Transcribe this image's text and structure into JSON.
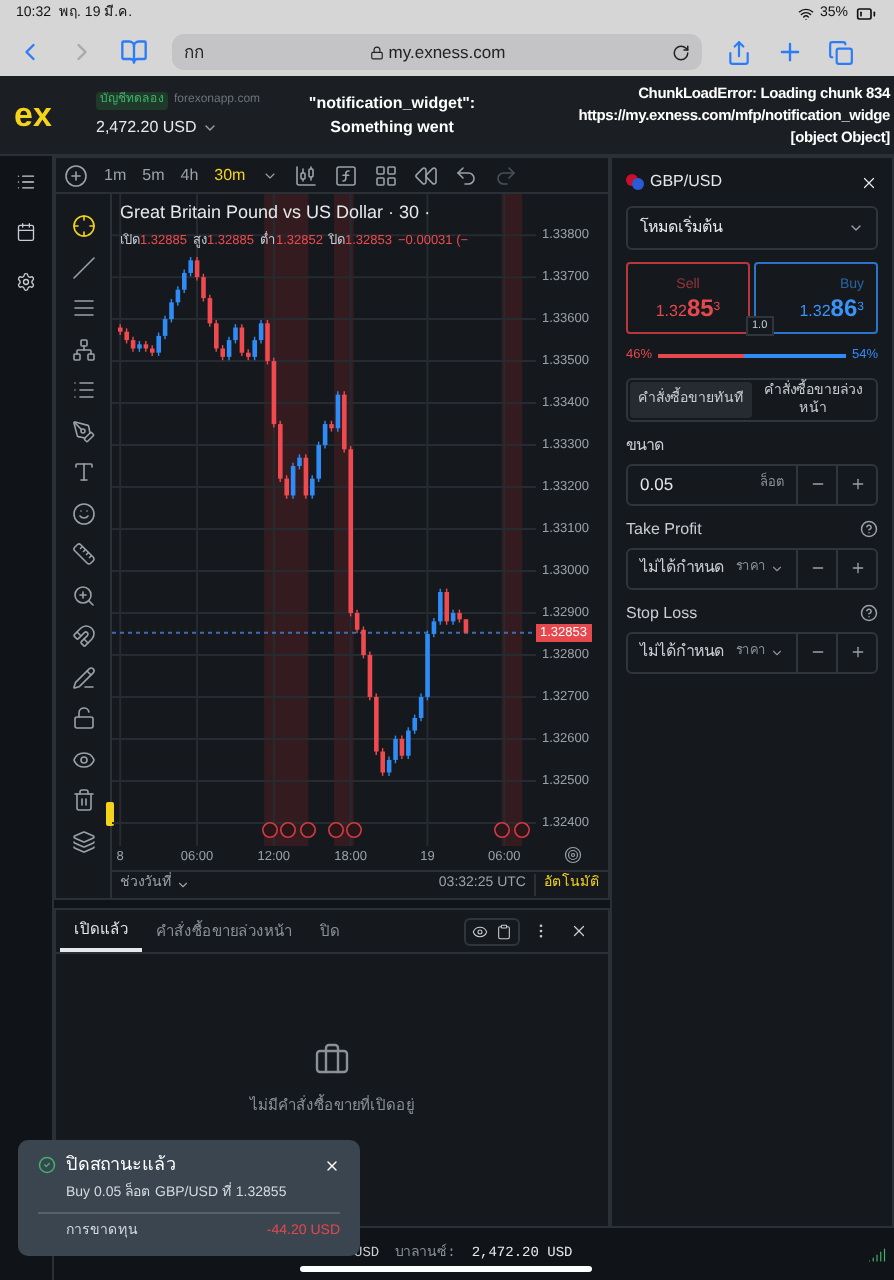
{
  "status_bar": {
    "time": "10:32",
    "date": "พฤ. 19 มี.ค.",
    "battery": "35%"
  },
  "browser": {
    "text_size_button": "กก",
    "url": "my.exness.com"
  },
  "header": {
    "logo": "ex",
    "account_type": "บัญชีทดลอง",
    "server": "forexonapp.com",
    "balance": "2,472.20 USD",
    "widget_error": [
      "\"notification_widget\":",
      "Something went"
    ],
    "chunk_error": [
      "ChunkLoadError: Loading chunk 834",
      "https://my.exness.com/mfp/notification_widge",
      "[object Object]"
    ]
  },
  "chart_toolbar": {
    "timeframes": [
      {
        "label": "1m",
        "selected": false
      },
      {
        "label": "5m",
        "selected": false
      },
      {
        "label": "4h",
        "selected": false
      },
      {
        "label": "30m",
        "selected": true
      }
    ]
  },
  "chart": {
    "title": "Great Britain Pound vs US Dollar · 30 ·",
    "ohlc": [
      {
        "label": "เปิด",
        "value": "1.32885"
      },
      {
        "label": "สูง",
        "value": "1.32885"
      },
      {
        "label": "ต่ำ",
        "value": "1.32852"
      },
      {
        "label": "ปิด",
        "value": "1.32853"
      }
    ],
    "change": "−0.00031 (−",
    "chart_data": {
      "type": "candlestick",
      "x": [
        0,
        0.5,
        1,
        1.5,
        2,
        2.5,
        3,
        3.5,
        4,
        4.5,
        5,
        5.5,
        6,
        6.5,
        7,
        7.5,
        8,
        8.5,
        9,
        9.5,
        10,
        10.5,
        11,
        11.5,
        12,
        12.5,
        13,
        13.5,
        14,
        14.5,
        15,
        15.5,
        16,
        16.5,
        17,
        17.5,
        18,
        18.5,
        19,
        19.5,
        20,
        20.5,
        21,
        21.5,
        22,
        22.5,
        23,
        23.5,
        24,
        24.5,
        25,
        25.5,
        26,
        26.5,
        27
      ],
      "ohlc": [
        [
          1.3358,
          1.33588,
          1.33562,
          1.3357
        ],
        [
          1.3357,
          1.33578,
          1.33542,
          1.3355
        ],
        [
          1.3355,
          1.33558,
          1.33522,
          1.3353
        ],
        [
          1.3353,
          1.33548,
          1.33522,
          1.3354
        ],
        [
          1.3354,
          1.33548,
          1.33522,
          1.3353
        ],
        [
          1.3353,
          1.33538,
          1.33512,
          1.3352
        ],
        [
          1.3352,
          1.33568,
          1.33512,
          1.3356
        ],
        [
          1.3356,
          1.33608,
          1.33552,
          1.336
        ],
        [
          1.336,
          1.33648,
          1.33592,
          1.3364
        ],
        [
          1.3364,
          1.33678,
          1.33632,
          1.3367
        ],
        [
          1.3367,
          1.33718,
          1.33662,
          1.3371
        ],
        [
          1.3371,
          1.33748,
          1.33702,
          1.3374
        ],
        [
          1.3374,
          1.33748,
          1.33692,
          1.337
        ],
        [
          1.337,
          1.33708,
          1.33642,
          1.3365
        ],
        [
          1.3365,
          1.33658,
          1.33582,
          1.3359
        ],
        [
          1.3359,
          1.33598,
          1.33522,
          1.3353
        ],
        [
          1.3353,
          1.33538,
          1.33502,
          1.3351
        ],
        [
          1.3351,
          1.33558,
          1.33502,
          1.3355
        ],
        [
          1.3355,
          1.33588,
          1.33542,
          1.3358
        ],
        [
          1.3358,
          1.33588,
          1.33512,
          1.3352
        ],
        [
          1.3352,
          1.33528,
          1.33502,
          1.3351
        ],
        [
          1.3351,
          1.33558,
          1.33502,
          1.3355
        ],
        [
          1.3355,
          1.33598,
          1.33542,
          1.3359
        ],
        [
          1.3359,
          1.33598,
          1.33492,
          1.335
        ],
        [
          1.335,
          1.33508,
          1.33342,
          1.3335
        ],
        [
          1.3335,
          1.33358,
          1.33212,
          1.3322
        ],
        [
          1.3322,
          1.33228,
          1.33172,
          1.3318
        ],
        [
          1.3318,
          1.33258,
          1.33172,
          1.3325
        ],
        [
          1.3325,
          1.33278,
          1.33242,
          1.3327
        ],
        [
          1.3327,
          1.33278,
          1.33172,
          1.3318
        ],
        [
          1.3318,
          1.33228,
          1.33172,
          1.3322
        ],
        [
          1.3322,
          1.33308,
          1.33212,
          1.333
        ],
        [
          1.333,
          1.33358,
          1.33292,
          1.3335
        ],
        [
          1.3335,
          1.33358,
          1.33332,
          1.3334
        ],
        [
          1.3334,
          1.33428,
          1.33332,
          1.3342
        ],
        [
          1.3342,
          1.33428,
          1.33282,
          1.3329
        ],
        [
          1.3329,
          1.33298,
          1.32892,
          1.329
        ],
        [
          1.329,
          1.32908,
          1.32852,
          1.3286
        ],
        [
          1.3286,
          1.32868,
          1.32792,
          1.328
        ],
        [
          1.328,
          1.32808,
          1.32692,
          1.327
        ],
        [
          1.327,
          1.32708,
          1.32562,
          1.3257
        ],
        [
          1.3257,
          1.32578,
          1.32512,
          1.3252
        ],
        [
          1.3252,
          1.32558,
          1.32512,
          1.3255
        ],
        [
          1.3255,
          1.32608,
          1.32542,
          1.326
        ],
        [
          1.326,
          1.32608,
          1.32552,
          1.3256
        ],
        [
          1.3256,
          1.32628,
          1.32552,
          1.3262
        ],
        [
          1.3262,
          1.32658,
          1.32612,
          1.3265
        ],
        [
          1.3265,
          1.32708,
          1.32642,
          1.327
        ],
        [
          1.327,
          1.32858,
          1.32692,
          1.3285
        ],
        [
          1.3285,
          1.32888,
          1.32842,
          1.3288
        ],
        [
          1.3288,
          1.32958,
          1.32872,
          1.3295
        ],
        [
          1.3295,
          1.32958,
          1.32872,
          1.3288
        ],
        [
          1.3288,
          1.32908,
          1.32872,
          1.329
        ],
        [
          1.329,
          1.32908,
          1.32877,
          1.32885
        ],
        [
          1.32885,
          1.32885,
          1.32852,
          1.32853
        ]
      ],
      "xlim": [
        -0.64,
        32.48
      ],
      "ylim": [
        1.32345,
        1.33898
      ],
      "grid": true,
      "bands": [
        {
          "axis": "x",
          "from": 11.25,
          "to": 14.7
        },
        {
          "axis": "x",
          "from": 16.7,
          "to": 18.25
        },
        {
          "axis": "x",
          "from": 29.8,
          "to": 31.4
        }
      ],
      "ref_lines": [
        {
          "axis": "y",
          "value": 1.32853
        }
      ],
      "yticks": [
        {
          "value": 1.338,
          "label": "1.33800"
        },
        {
          "value": 1.337,
          "label": "1.33700"
        },
        {
          "value": 1.336,
          "label": "1.33600"
        },
        {
          "value": 1.335,
          "label": "1.33500"
        },
        {
          "value": 1.334,
          "label": "1.33400"
        },
        {
          "value": 1.333,
          "label": "1.33300"
        },
        {
          "value": 1.332,
          "label": "1.33200"
        },
        {
          "value": 1.331,
          "label": "1.33100"
        },
        {
          "value": 1.33,
          "label": "1.33000"
        },
        {
          "value": 1.329,
          "label": "1.32900"
        },
        {
          "value": 1.328,
          "label": "1.32800"
        },
        {
          "value": 1.327,
          "label": "1.32700"
        },
        {
          "value": 1.326,
          "label": "1.32600"
        },
        {
          "value": 1.325,
          "label": "1.32500"
        },
        {
          "value": 1.324,
          "label": "1.32400"
        }
      ],
      "xticks": [
        {
          "value": 6,
          "label": "06:00"
        },
        {
          "value": 12,
          "label": "12:00"
        },
        {
          "value": 18,
          "label": "18:00"
        }
      ]
    },
    "day_labels": [
      "8",
      "19",
      "06:00"
    ],
    "current_price": "1.32853",
    "date_range": "ช่วงวันที่",
    "clock": "03:32:25 UTC",
    "auto": "อัตโนมัติ"
  },
  "order_panel": {
    "symbol": "GBP/USD",
    "mode": "โหมดเริ่มต้น",
    "sell": {
      "label": "Sell",
      "price": "1.32",
      "big": "85",
      "sup": "3"
    },
    "buy": {
      "label": "Buy",
      "price": "1.32",
      "big": "86",
      "sup": "3"
    },
    "spread": "1.0",
    "sell_share": "46%",
    "buy_share": "54%",
    "level": 0.46,
    "order_types": [
      {
        "label": "คำสั่งซื้อขายทันที",
        "selected": true
      },
      {
        "label": "คำสั่งซื้อขายล่วงหน้า",
        "selected": false
      }
    ],
    "fields": [
      {
        "label": "ขนาด",
        "value": "0.05",
        "unit": "ล็อต",
        "help": false
      },
      {
        "label": "Take Profit",
        "placeholder": "ไม่ได้กำหนด",
        "unit": "ราคา",
        "help": true
      },
      {
        "label": "Stop Loss",
        "placeholder": "ไม่ได้กำหนด",
        "unit": "ราคา",
        "help": true
      }
    ]
  },
  "positions_panel": {
    "tabs": [
      {
        "label": "เปิดแล้ว",
        "selected": true
      },
      {
        "label": "คำสั่งซื้อขายล่วงหน้า",
        "selected": false
      },
      {
        "label": "ปิด",
        "selected": false
      }
    ],
    "empty_message": "ไม่มีคำสั่งซื้อขายที่เปิดอยู่"
  },
  "toast": {
    "title": "ปิดสถานะแล้ว",
    "message": "Buy 0.05 ล็อต GBP/USD ที่ 1.32855",
    "result_label": "การขาดทุน",
    "result_value": "-44.20 USD"
  },
  "footer": {
    "currency": "USD",
    "balance_label": "บาลานซ์:",
    "balance": "2,472.20 USD"
  }
}
